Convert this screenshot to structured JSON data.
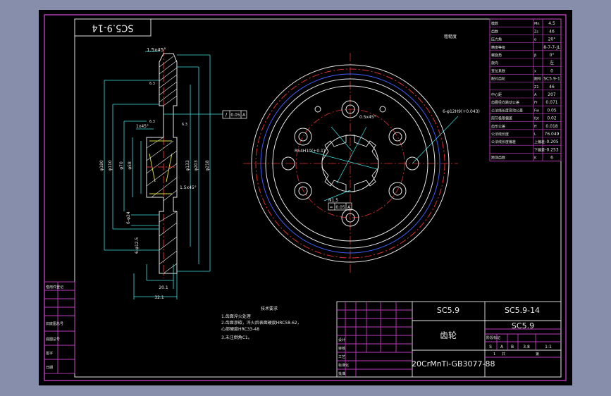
{
  "drawing": {
    "corner_code": "SC5.9-14",
    "part_name": "齿轮",
    "material": "20CrMnTi-GB3077-88",
    "title_code_left": "SC5.9",
    "title_code_right": "SC5.9-14",
    "assembly_code": "SC5.9",
    "scale": "1:1",
    "mass_weight": "3.8",
    "stage_marks": [
      "S",
      "A",
      "B"
    ],
    "page_of": "1"
  },
  "param_table": {
    "rows": [
      {
        "label": "模数",
        "sym": "Mn",
        "val": "4.5"
      },
      {
        "label": "齿数",
        "sym": "Zs",
        "val": "46"
      },
      {
        "label": "压力角",
        "sym": "α",
        "val": "20°"
      },
      {
        "label": "精度等级",
        "sym": "",
        "val": "8-7-7-JL"
      },
      {
        "label": "螺旋角",
        "sym": "β",
        "val": "0°"
      },
      {
        "label": "旋向",
        "sym": "",
        "val": "左"
      },
      {
        "label": "变位系数",
        "sym": "x",
        "val": "0"
      },
      {
        "label": "配对齿轮",
        "sym": "图号",
        "val": "SC5.9-1"
      },
      {
        "label": "",
        "sym": "Z1",
        "val": "46"
      },
      {
        "label": "中心距",
        "sym": "A",
        "val": "207"
      },
      {
        "label": "齿圈径向跳动公差",
        "sym": "Fr",
        "val": "0.071"
      },
      {
        "label": "公法线长度变动公差",
        "sym": "Fw",
        "val": "0.05"
      },
      {
        "label": "周节极限偏差",
        "sym": "fpt",
        "val": "0.02"
      },
      {
        "label": "齿形公差",
        "sym": "ff",
        "val": "0.018"
      },
      {
        "label": "公法线长度",
        "sym": "L",
        "val": "76.049"
      },
      {
        "label": "公法线长度偏差",
        "sym": "上偏差",
        "val": "-0.205"
      },
      {
        "label": "",
        "sym": "下偏差",
        "val": "-0.253"
      },
      {
        "label": "跨测齿数",
        "sym": "K",
        "val": "6"
      }
    ]
  },
  "section_view": {
    "chamfer_top": "1.5x45°",
    "dims": [
      "φ180",
      "φ110",
      "φ70",
      "φ58",
      "φ133",
      "φ203",
      "φ218"
    ],
    "roughness": [
      "6.3",
      "6.3",
      "6.3"
    ],
    "chamfer_mid": "1x45°",
    "chamfer_low": "1.5x45°",
    "tolerance_frame": [
      "/",
      "0.05",
      "A"
    ],
    "small_dims": [
      "6-φ24",
      "6-φ12.5"
    ],
    "width_dims": [
      "20.1",
      "32.1"
    ]
  },
  "front_view": {
    "keyway": "0.5x45°",
    "spline": "6-φ12H9(+0.043)",
    "spline2": "R54H10(+0.1)",
    "spline3": "N1.5",
    "tol_box": [
      "=",
      "0.05",
      "A"
    ],
    "side_label": "粗糙度"
  },
  "notes": {
    "title": "技术要求",
    "items": [
      "1.齿面淬火处理",
      "2.齿面渗碳，淬火后表面硬度HRC58-62，",
      "  心部硬度HRC33-48",
      "3.未注倒角C1。"
    ]
  },
  "left_table": {
    "rows": [
      "借用件登记",
      "",
      "",
      "旧底图总号",
      "底图总号",
      "签字",
      "日期"
    ]
  },
  "title_block": {
    "rev_labels": [
      "标记",
      "处数",
      "分区",
      "更改文件号",
      "签名",
      "年月日"
    ],
    "roles": [
      "设计",
      "审核",
      "工艺",
      "标准化",
      "批准"
    ],
    "stage_label": "阶段标记",
    "weight_label": "重量",
    "scale_label": "比例",
    "sheet_label": "共",
    "sheet_label2": "张",
    "sheet_label3": "第"
  }
}
